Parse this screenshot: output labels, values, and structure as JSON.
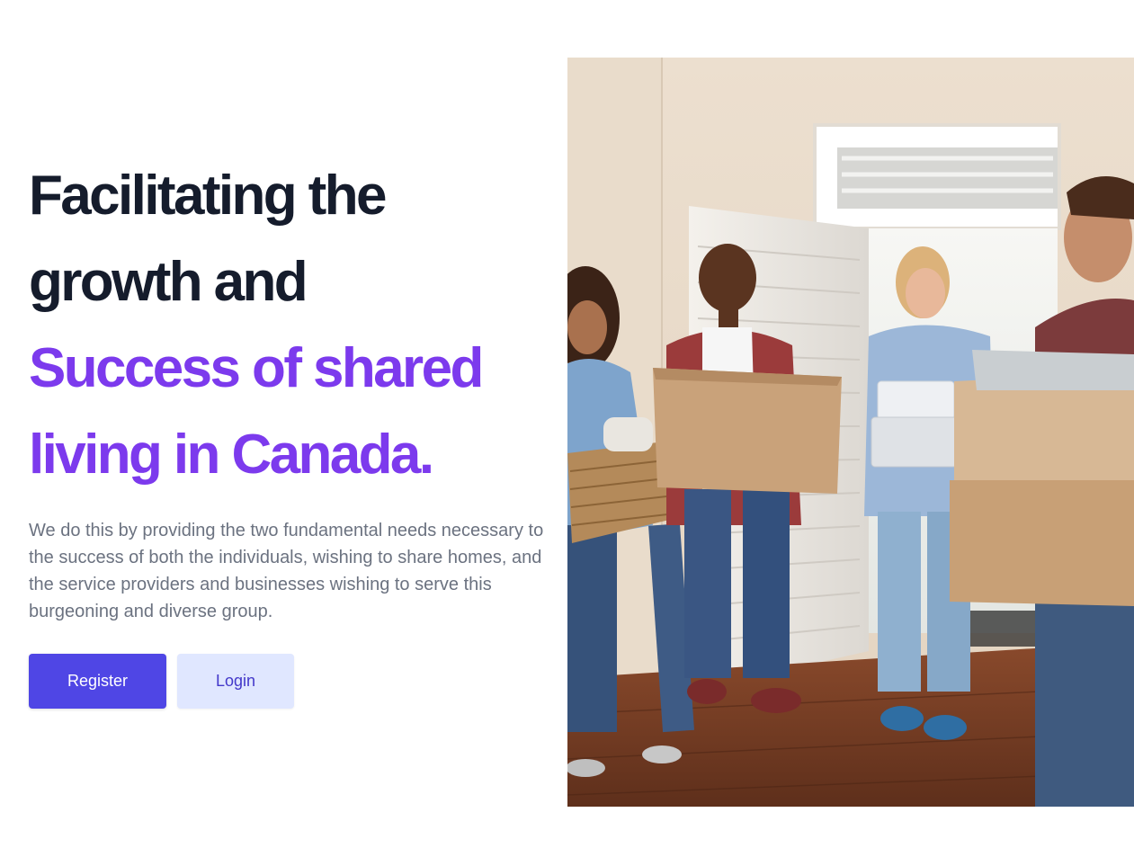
{
  "hero": {
    "headline": {
      "line1": "Facilitating the",
      "line2": "growth and",
      "line3": "Success of shared",
      "line4": "living in Canada."
    },
    "description": "We do this by providing the two fundamental needs necessary to the success of both the individuals, wishing to share homes, and the service providers and businesses wishing to serve this burgeoning and diverse group.",
    "buttons": {
      "register_label": "Register",
      "login_label": "Login"
    },
    "image": {
      "alt": "People carrying moving boxes into a new home"
    }
  },
  "colors": {
    "heading": "#151c2c",
    "accent": "#7c3aed",
    "body_text": "#6b7280",
    "primary_button": "#4f46e5",
    "secondary_button_bg": "#e0e7ff",
    "secondary_button_text": "#4338ca"
  }
}
